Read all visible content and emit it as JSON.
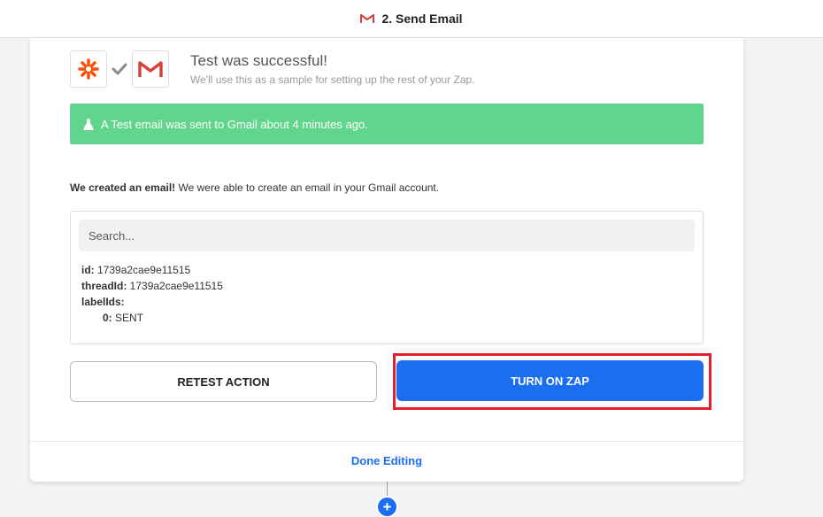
{
  "header": {
    "step_title": "2. Send Email",
    "app_icon": "gmail-icon"
  },
  "test_result": {
    "icons": [
      "zapier-icon",
      "checkmark-icon",
      "gmail-icon"
    ],
    "title": "Test was successful!",
    "subtitle": "We'll use this as a sample for setting up the rest of your Zap."
  },
  "alert": {
    "icon": "flask-icon",
    "text": "A Test email was sent to Gmail about 4 minutes ago.",
    "color": "#62d58c"
  },
  "created": {
    "bold": "We created an email!",
    "text": " We were able to create an email in your Gmail account."
  },
  "data_view": {
    "search_placeholder": "Search...",
    "fields": [
      {
        "key": "id:",
        "value": " 1739a2cae9e11515"
      },
      {
        "key": "threadId:",
        "value": " 1739a2cae9e11515"
      },
      {
        "key": "labelIds:",
        "value": ""
      }
    ],
    "label_ids": [
      {
        "key": "0:",
        "value": " SENT"
      }
    ]
  },
  "actions": {
    "retest_label": "RETEST ACTION",
    "turn_on_label": "TURN ON ZAP",
    "primary_color": "#1b6ef0",
    "highlight_color": "#e0202a"
  },
  "footer": {
    "done_label": "Done Editing",
    "add_step_icon": "plus-icon"
  }
}
